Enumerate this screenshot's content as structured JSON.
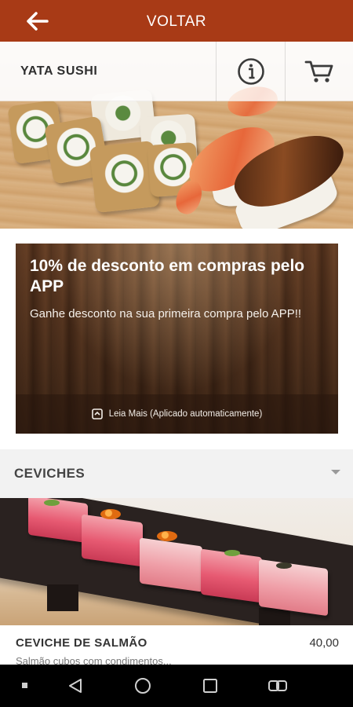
{
  "topbar": {
    "title": "VOLTAR"
  },
  "restaurant": {
    "name": "YATA SUSHI"
  },
  "promo": {
    "title": "10% de desconto em compras pelo APP",
    "description": "Ganhe desconto na sua primeira compra pelo APP!!",
    "more_label": "Leia Mais (Aplicado automaticamente)"
  },
  "section": {
    "title": "CEVICHES"
  },
  "product": {
    "name": "CEVICHE DE SALMÃO",
    "price": "40,00",
    "description": "Salmão cubos com condimentos..."
  },
  "colors": {
    "brand": "#a83a16",
    "section_bg": "#f2f2f2"
  },
  "icons": {
    "back": "arrow-left-icon",
    "info": "info-icon",
    "cart": "cart-icon",
    "expand": "chevron-down-icon",
    "read_more": "expand-icon"
  }
}
